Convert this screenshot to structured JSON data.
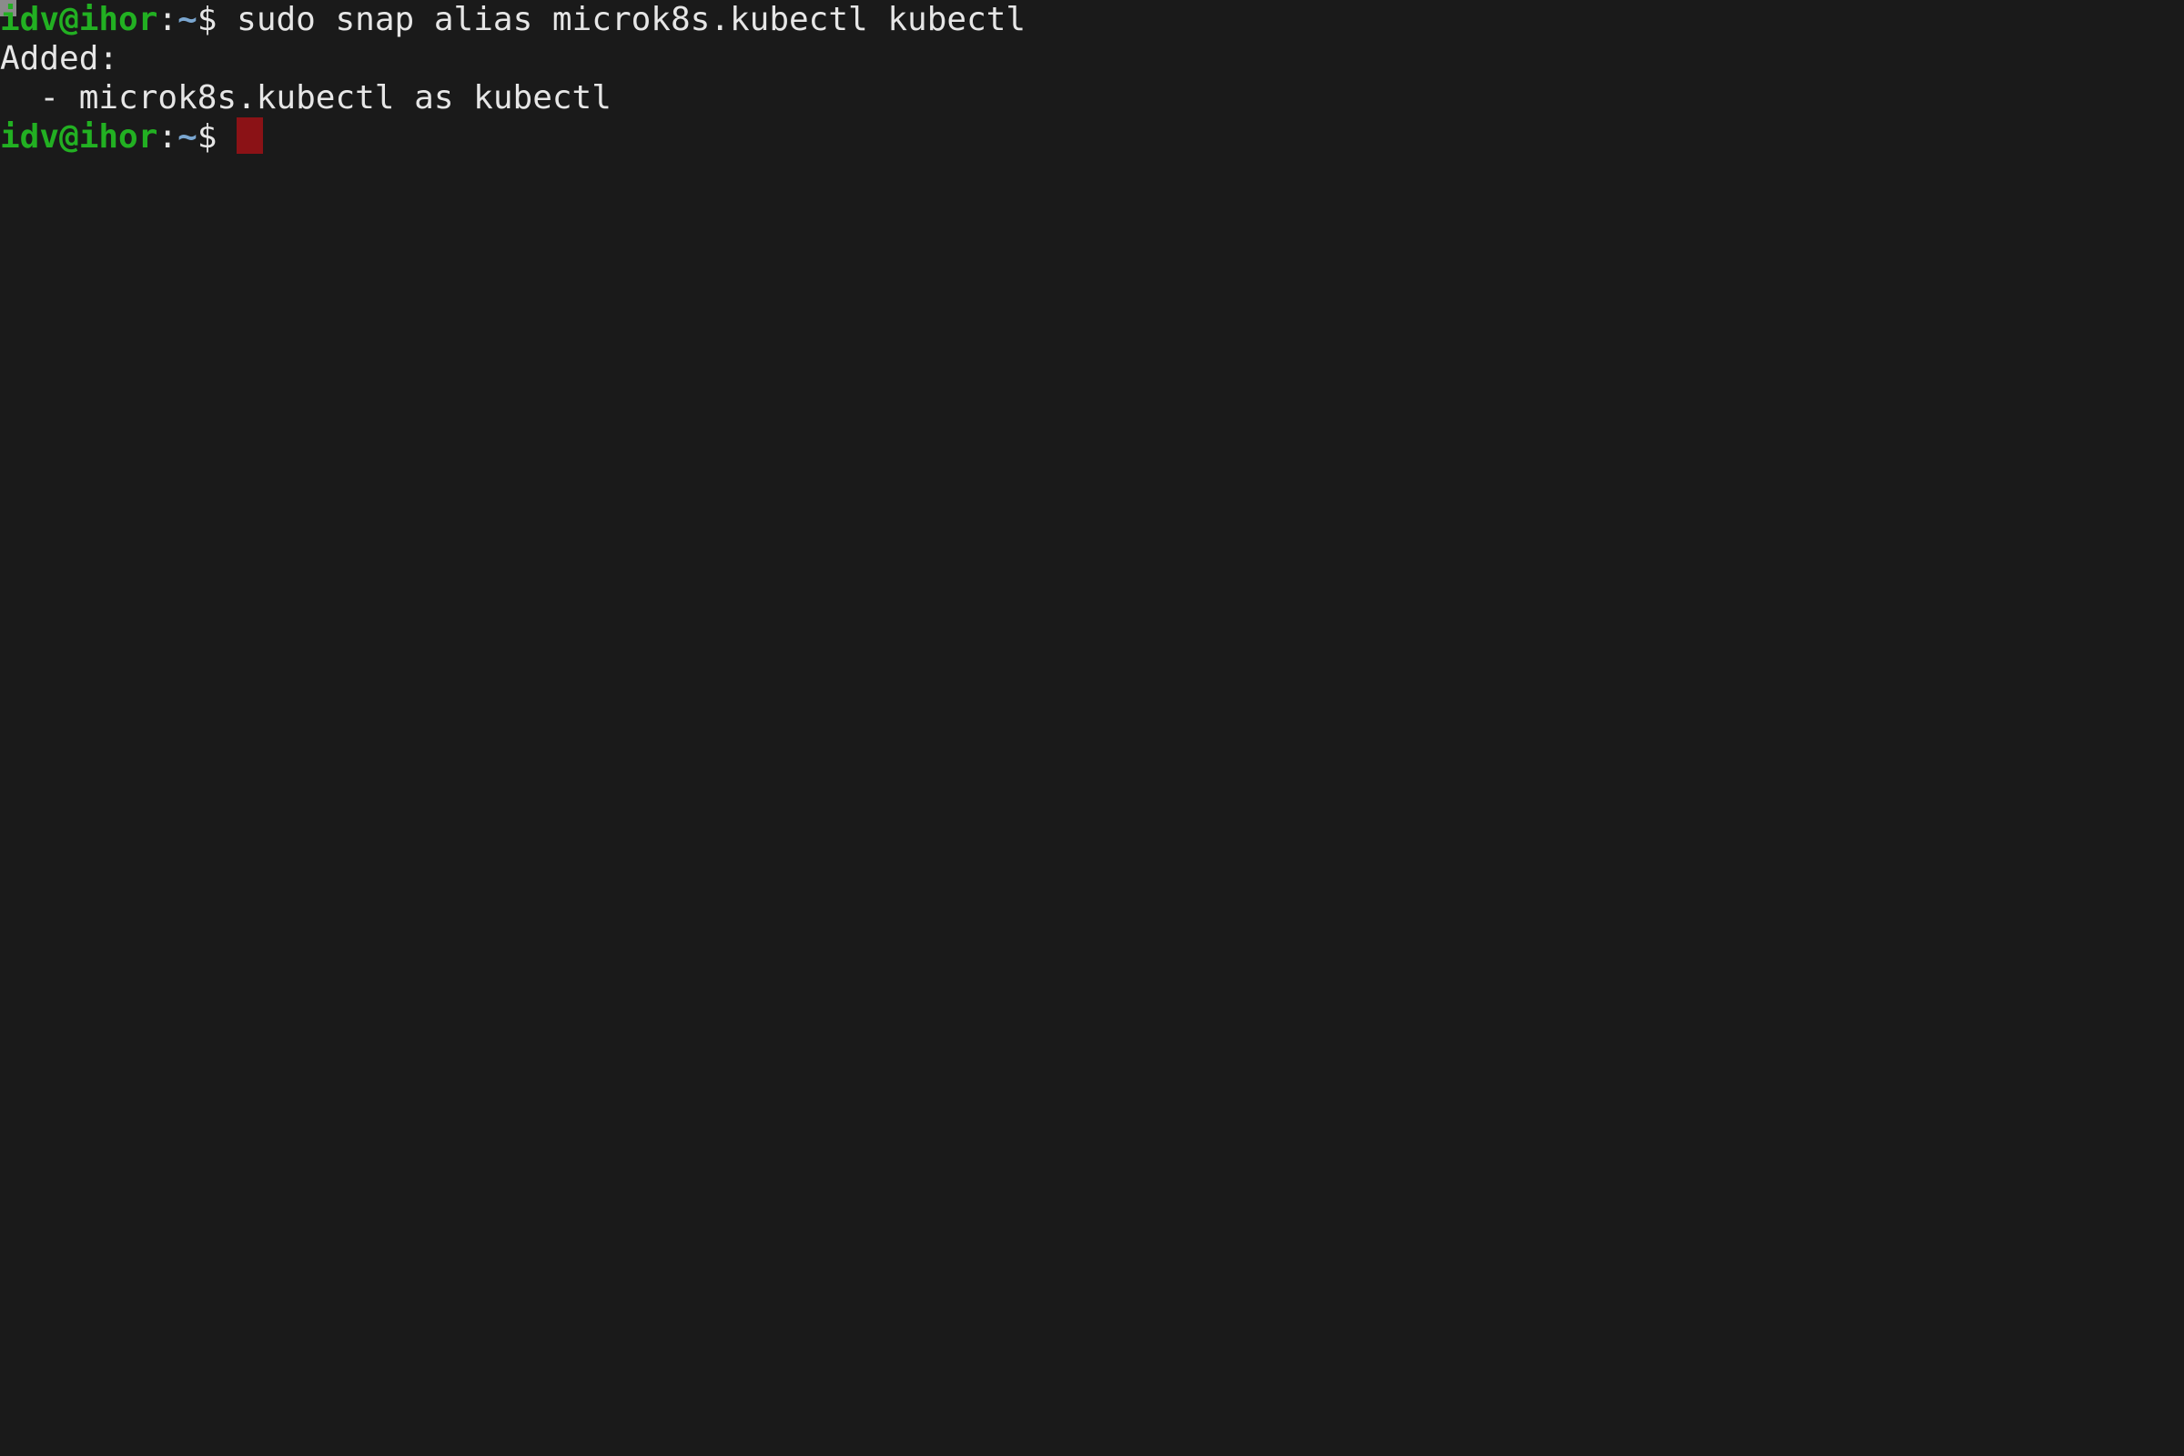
{
  "terminal": {
    "background_color": "#1a1a1a",
    "foreground_color": "#e6e6e6",
    "prompt_user_color": "#22b022",
    "prompt_path_color": "#7aa6d0",
    "cursor_color": "#8b1216",
    "artifact_color": "#8b8b8b",
    "lines": [
      {
        "type": "prompt-command",
        "prompt_user_host": "idv@ihor",
        "prompt_colon": ":",
        "prompt_path": "~",
        "prompt_dollar": "$",
        "prompt_space": " ",
        "command": "sudo snap alias microk8s.kubectl kubectl"
      },
      {
        "type": "output",
        "text": "Added:"
      },
      {
        "type": "output",
        "text": "  - microk8s.kubectl as kubectl"
      },
      {
        "type": "prompt-cursor",
        "prompt_user_host": "idv@ihor",
        "prompt_colon": ":",
        "prompt_path": "~",
        "prompt_dollar": "$",
        "prompt_space": " ",
        "command": ""
      }
    ]
  }
}
